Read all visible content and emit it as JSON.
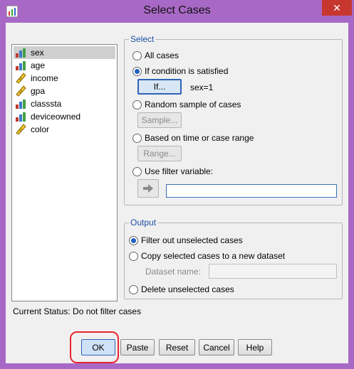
{
  "window": {
    "title": "Select Cases",
    "close_glyph": "✕"
  },
  "variables": [
    {
      "name": "sex",
      "type": "nominal"
    },
    {
      "name": "age",
      "type": "nominal"
    },
    {
      "name": "income",
      "type": "scale"
    },
    {
      "name": "gpa",
      "type": "scale"
    },
    {
      "name": "classsta",
      "type": "nominal"
    },
    {
      "name": "deviceowned",
      "type": "nominal"
    },
    {
      "name": "color",
      "type": "scale"
    }
  ],
  "select_group": {
    "title": "Select",
    "all_cases": "All cases",
    "if_condition": "If condition is satisfied",
    "if_button": "If...",
    "condition_text": "sex=1",
    "random_sample": "Random sample of cases",
    "sample_button": "Sample...",
    "time_range": "Based on time or case range",
    "range_button": "Range...",
    "filter_variable": "Use filter variable:",
    "selected": "if_condition"
  },
  "output_group": {
    "title": "Output",
    "filter_out": "Filter out unselected cases",
    "copy_dataset": "Copy selected cases to a new dataset",
    "dataset_name_label": "Dataset name:",
    "delete_cases": "Delete unselected cases",
    "selected": "filter_out"
  },
  "status": "Current Status: Do not filter cases",
  "buttons": {
    "ok": "OK",
    "paste": "Paste",
    "reset": "Reset",
    "cancel": "Cancel",
    "help": "Help"
  },
  "colors": {
    "titlebar": "#a869c6",
    "accent": "#1f5fbf",
    "close": "#c7372f",
    "highlight": "#e8262e"
  }
}
